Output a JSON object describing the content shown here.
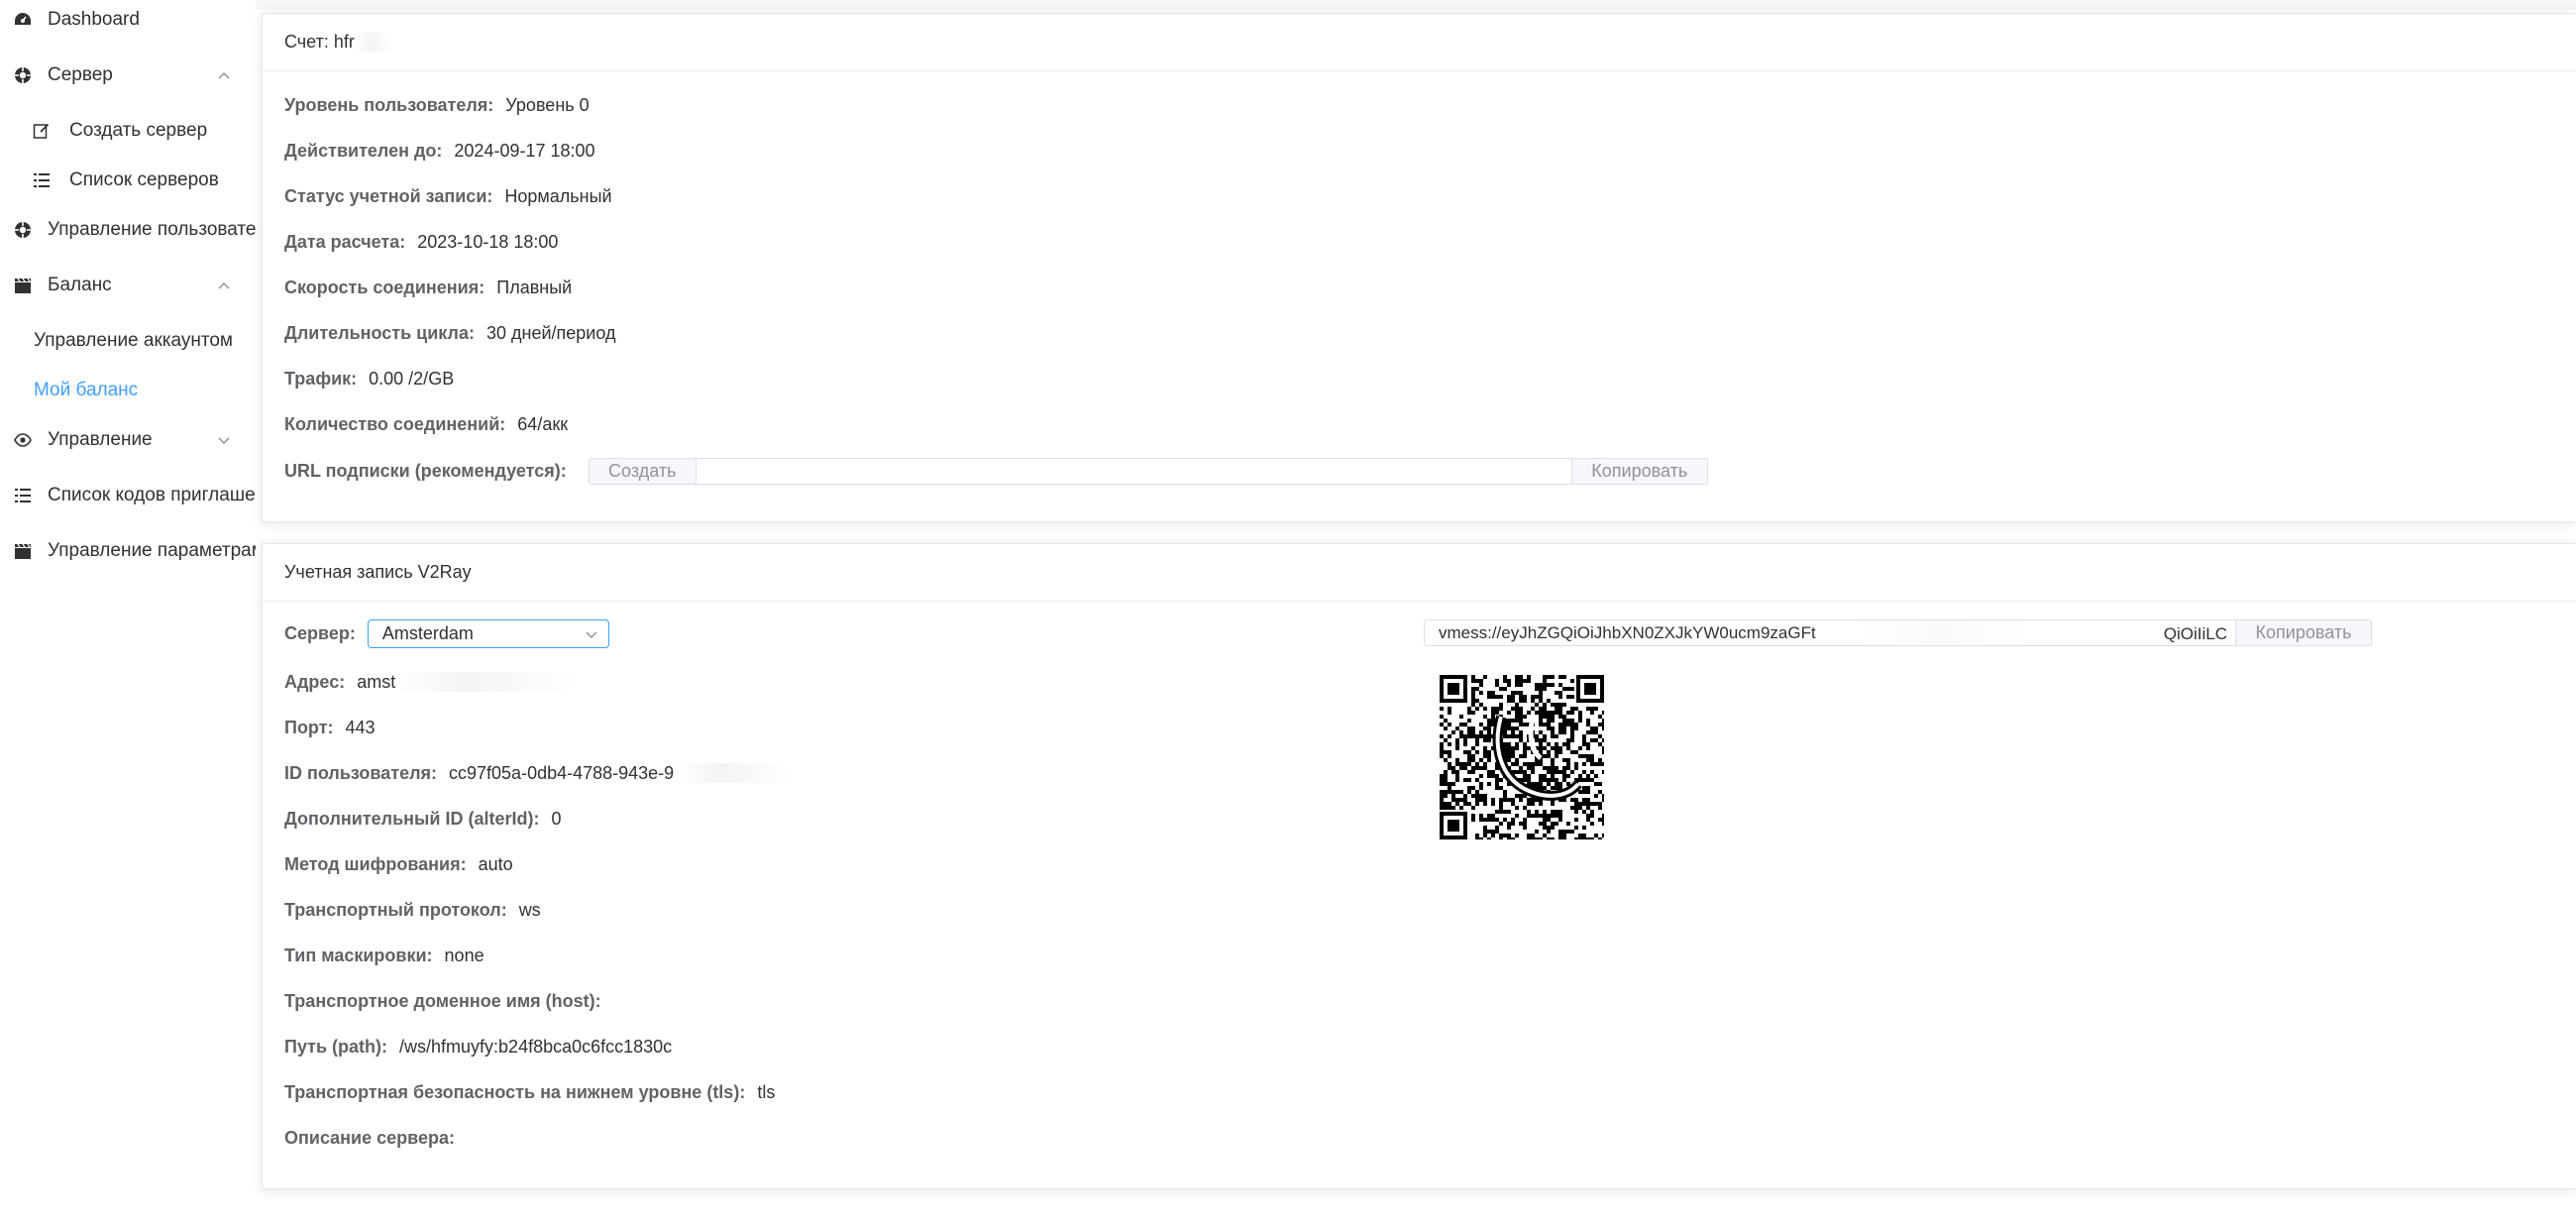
{
  "sidebar": {
    "items": [
      {
        "label": "Dashboard",
        "icon": "dashboard-icon"
      },
      {
        "label": "Сервер",
        "icon": "server-icon",
        "expanded": true
      },
      {
        "label": "Создать сервер",
        "icon": "edit-icon"
      },
      {
        "label": "Список серверов",
        "icon": "list-icon"
      },
      {
        "label": "Управление пользователями",
        "icon": "users-icon"
      },
      {
        "label": "Баланс",
        "icon": "clapperboard-icon",
        "expanded": true
      },
      {
        "label": "Управление аккаунтом"
      },
      {
        "label": "Мой баланс",
        "active": true
      },
      {
        "label": "Управление",
        "icon": "eye-icon",
        "expanded": false
      },
      {
        "label": "Список кодов приглашения",
        "icon": "list-icon"
      },
      {
        "label": "Управление параметрами",
        "icon": "clapperboard-icon"
      }
    ],
    "active_color": "#409eff"
  },
  "account_card": {
    "title": "Счет: hfr",
    "fields": [
      {
        "label": "Уровень пользователя:",
        "value": "Уровень 0"
      },
      {
        "label": "Действителен до:",
        "value": "2024-09-17 18:00"
      },
      {
        "label": "Статус учетной записи:",
        "value": "Нормальный"
      },
      {
        "label": "Дата расчета:",
        "value": "2023-10-18 18:00"
      },
      {
        "label": "Скорость соединения:",
        "value": "Плавный"
      },
      {
        "label": "Длительность цикла:",
        "value": "30 дней/период"
      },
      {
        "label": "Трафик:",
        "value": "0.00 /2/GB"
      },
      {
        "label": "Количество соединений:",
        "value": "64/акк"
      }
    ],
    "subscription": {
      "label": "URL подписки (рекомендуется):",
      "create_button": "Создать",
      "copy_button": "Копировать",
      "value": ""
    }
  },
  "v2ray_card": {
    "title": "Учетная запись V2Ray",
    "server_label": "Сервер:",
    "server_selected": "Amsterdam",
    "fields": [
      {
        "label": "Адрес:",
        "value": "amst"
      },
      {
        "label": "Порт:",
        "value": "443"
      },
      {
        "label": "ID пользователя:",
        "value": "cc97f05a-0db4-4788-943e-9"
      },
      {
        "label": "Дополнительный ID (alterId):",
        "value": "0"
      },
      {
        "label": "Метод шифрования:",
        "value": "auto"
      },
      {
        "label": "Транспортный протокол:",
        "value": "ws"
      },
      {
        "label": "Тип маскировки:",
        "value": "none"
      },
      {
        "label": "Транспортное доменное имя (host):",
        "value": ""
      },
      {
        "label": "Путь (path):",
        "value": "/ws/hfmuyfy:b24f8bca0c6fcc1830c"
      },
      {
        "label": "Транспортная безопасность на нижнем уровне (tls):",
        "value": "tls"
      },
      {
        "label": "Описание сервера:",
        "value": ""
      }
    ],
    "vmess_link": "vmess://eyJhZGQiOiJhbXN0ZXJkYW0ucm9zaGFt",
    "vmess_link_tail": "QiOiIiLC",
    "copy_button": "Копировать"
  }
}
